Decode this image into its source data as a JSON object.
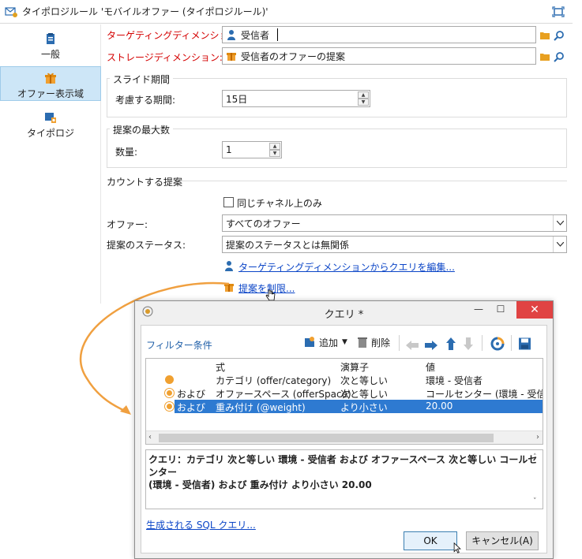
{
  "main_window": {
    "title": "タイポロジルール 'モバイルオファー (タイポロジルール)'"
  },
  "sidebar": {
    "items": [
      {
        "label": "一般",
        "icon": "clipboard-icon"
      },
      {
        "label": "オファー表示域",
        "icon": "gift-icon",
        "selected": true
      },
      {
        "label": "タイポロジ",
        "icon": "typology-icon"
      }
    ]
  },
  "form": {
    "targeting_dimension": {
      "label": "ターゲティングディメンション:",
      "value": "受信者"
    },
    "storage_dimension": {
      "label": "ストレージディメンション:",
      "value": "受信者のオファーの提案"
    },
    "slide_period": {
      "group_title": "スライド期間",
      "period_label": "考慮する期間:",
      "period_value": "15日"
    },
    "max_propositions": {
      "group_title": "提案の最大数",
      "count_label": "数量:",
      "count_value": "1"
    },
    "counted_propositions": {
      "section_title": "カウントする提案",
      "same_channel_label": "同じチャネル上のみ",
      "same_channel_checked": false,
      "offer_label": "オファー:",
      "offer_value": "すべてのオファー",
      "status_label": "提案のステータス:",
      "status_value": "提案のステータスとは無関係",
      "edit_query_link": "ターゲティングディメンションからクエリを編集...",
      "restrict_link": "提案を制限..."
    }
  },
  "dialog": {
    "title": "クエリ *",
    "filter_label": "フィルター条件",
    "toolbar": {
      "add_label": "追加",
      "delete_label": "削除"
    },
    "grid": {
      "columns": [
        "式",
        "演算子",
        "値"
      ],
      "rows": [
        {
          "prefix": "",
          "expression": "カテゴリ (offer/category)",
          "operator": "次と等しい",
          "value": "環境 - 受信者"
        },
        {
          "prefix": "および",
          "expression": "オファースペース (offerSpace)",
          "operator": "次と等しい",
          "value": "コールセンター (環境 - 受信者"
        },
        {
          "prefix": "および",
          "expression": "重み付け (@weight)",
          "operator": "より小さい",
          "value": "20.00",
          "selected": true
        }
      ]
    },
    "summary_line1": "クエリ：カテゴリ 次と等しい 環境 - 受信者 および オファースペース 次と等しい コールセンター",
    "summary_line2": "(環境 - 受信者) および 重み付け より小さい 20.00",
    "sql_link": "生成される SQL クエリ...",
    "ok_label": "OK",
    "cancel_label": "キャンセル(A)"
  },
  "colors": {
    "accent_blue": "#2e7ad1",
    "required_red": "#d40000",
    "callout_orange": "#f0a040",
    "close_red": "#e04343"
  }
}
